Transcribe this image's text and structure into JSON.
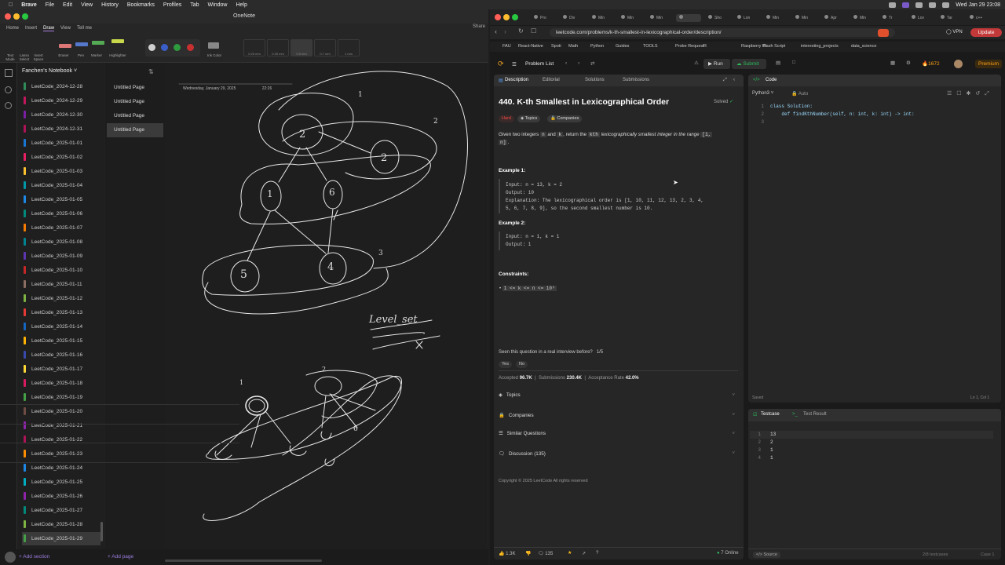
{
  "menubar": {
    "app": "Brave",
    "items": [
      "File",
      "Edit",
      "View",
      "History",
      "Bookmarks",
      "Profiles",
      "Tab",
      "Window",
      "Help"
    ],
    "datetime": "Wed Jan 29  23:08"
  },
  "onenote": {
    "title": "OneNote",
    "tabs": [
      "Home",
      "Insert",
      "Draw",
      "View",
      "Tell me"
    ],
    "share": "Share",
    "tools": [
      "Text Mode",
      "Lasso Select",
      "Insert Space",
      "Eraser",
      "Pen",
      "Marker",
      "Highlighter"
    ],
    "ink_color": "Ink Color",
    "pen_sizes": [
      "0.25 mm",
      "0.35 mm",
      "0.5 mm",
      "0.7 mm",
      "1 mm"
    ],
    "notebook": "Fanchen's Notebook",
    "sections": [
      "LeetCode_2024-12-28",
      "LeetCode_2024-12-29",
      "LeetCode_2024-12-30",
      "LeetCode_2024-12-31",
      "LeetCode_2025-01-01",
      "LeetCode_2025-01-02",
      "LeetCode_2025-01-03",
      "LeetCode_2025-01-04",
      "LeetCode_2025-01-05",
      "LeetCode_2025-01-06",
      "LeetCode_2025-01-07",
      "LeetCode_2025-01-08",
      "LeetCode_2025-01-09",
      "LeetCode_2025-01-10",
      "LeetCode_2025-01-11",
      "LeetCode_2025-01-12",
      "LeetCode_2025-01-13",
      "LeetCode_2025-01-14",
      "LeetCode_2025-01-15",
      "LeetCode_2025-01-16",
      "LeetCode_2025-01-17",
      "LeetCode_2025-01-18",
      "LeetCode_2025-01-19",
      "LeetCode_2025-01-20",
      "LeetCode_2025-01-21",
      "LeetCode_2025-01-22",
      "LeetCode_2025-01-23",
      "LeetCode_2025-01-24",
      "LeetCode_2025-01-25",
      "LeetCode_2025-01-26",
      "LeetCode_2025-01-27",
      "LeetCode_2025-01-28",
      "LeetCode_2025-01-29"
    ],
    "section_colors": [
      "#2e8b57",
      "#c2185b",
      "#7b1fa2",
      "#ad1457",
      "#1976d2",
      "#e91e63",
      "#fbc02d",
      "#0097a7",
      "#1e88e5",
      "#00897b",
      "#f57c00",
      "#00838f",
      "#5e35b1",
      "#c62828",
      "#8d6e63",
      "#7cb342",
      "#e53935",
      "#1565c0",
      "#ffb300",
      "#3949ab",
      "#fdd835",
      "#d81b60",
      "#43a047",
      "#6d4c41",
      "#8e24aa",
      "#ad1457",
      "#fb8c00",
      "#1e88e5",
      "#00acc1",
      "#8e24aa",
      "#00897b",
      "#7cb342",
      "#43a047"
    ],
    "pages": [
      "Untitled Page",
      "Untitled Page",
      "Untitled Page",
      "Untitled Page"
    ],
    "note_date": "Wednesday, January 29, 2025",
    "note_time": "22:26",
    "ink_text": {
      "n1": "1",
      "n2": "2",
      "n3": "2",
      "n4": "1",
      "n5": "6",
      "n6": "5",
      "n7": "4",
      "n8": "2",
      "n9": "3",
      "n10": "3",
      "label": "Level_set",
      "x": "x",
      "g1": "1",
      "g2": "2",
      "g3": "6"
    },
    "add_section": "Add section",
    "add_page": "Add page"
  },
  "browser": {
    "tabs": [
      "Pro",
      "Div",
      "Min",
      "Min",
      "Min",
      "",
      "Sho",
      "Lon",
      "Min",
      "Min",
      "Apr",
      "Min",
      "Tr",
      "Lov",
      "Tar",
      "c++"
    ],
    "url": "leetcode.com/problems/k-th-smallest-in-lexicographical-order/description/",
    "vpn": "VPN",
    "update": "Update",
    "bookmarks": [
      "FAU",
      "React-Native",
      "Spoti",
      "Math",
      "Python",
      "Guides",
      "TOOLS",
      "Probe Request",
      "R",
      "Raspberry Pi",
      "Bash Script",
      "interesting_projects",
      "data_science"
    ]
  },
  "lc": {
    "problem_list": "Problem List",
    "run": "Run",
    "submit": "Submit",
    "streak": "1672",
    "premium": "Premium",
    "desc_tabs": [
      "Description",
      "Editorial",
      "Solutions",
      "Submissions"
    ],
    "title": "440. K-th Smallest in Lexicographical Order",
    "solved": "Solved",
    "difficulty": "Hard",
    "topics_tag": "Topics",
    "companies_tag": "Companies",
    "statement_1": "Given two integers ",
    "n": "n",
    "and": " and ",
    "k": "k",
    "statement_2": ", return the ",
    "kth": "kth",
    "statement_3": " lexicographically smallest integer in the range ",
    "range_a": "[1,",
    "range_b": "n]",
    "dot": ".",
    "ex1_title": "Example 1:",
    "ex1_input": "Input: n = 13, k = 2",
    "ex1_output": "Output: 10",
    "ex1_expl_1": "Explanation: The lexicographical order is [1, 10, 11, 12, 13, 2, 3, 4,",
    "ex1_expl_2": "5, 6, 7, 8, 9], so the second smallest number is 10.",
    "ex2_title": "Example 2:",
    "ex2_input": "Input: n = 1, k = 1",
    "ex2_output": "Output: 1",
    "constraints_title": "Constraints:",
    "constraint": "1 <= k <= n <= 10⁹",
    "interview_q": "Seen this question in a real interview before?",
    "interview_count": "1/5",
    "yes": "Yes",
    "no": "No",
    "accepted_label": "Accepted",
    "accepted": "96.7K",
    "submissions_label": "Submissions",
    "submissions": "230.4K",
    "rate_label": "Acceptance Rate",
    "rate": "42.0%",
    "sections": [
      "Topics",
      "Companies",
      "Similar Questions",
      "Discussion (135)"
    ],
    "copyright": "Copyright © 2025 LeetCode All rights reserved",
    "likes": "1.3K",
    "comments": "135",
    "online": "7 Online",
    "code_tab": "Code",
    "lang": "Python3",
    "auto": "Auto",
    "code_lines": [
      "class Solution:",
      "    def findKthNumber(self, n: int, k: int) -> int:",
      ""
    ],
    "saved": "Saved",
    "cursor": "Ln 1, Col 1",
    "testcase": "Testcase",
    "test_result": "Test Result",
    "test_lines": [
      "13",
      "2",
      "1",
      "1"
    ],
    "source": "Source",
    "tc_footer": "2/8 testcases",
    "tc_case": "Case 1"
  }
}
